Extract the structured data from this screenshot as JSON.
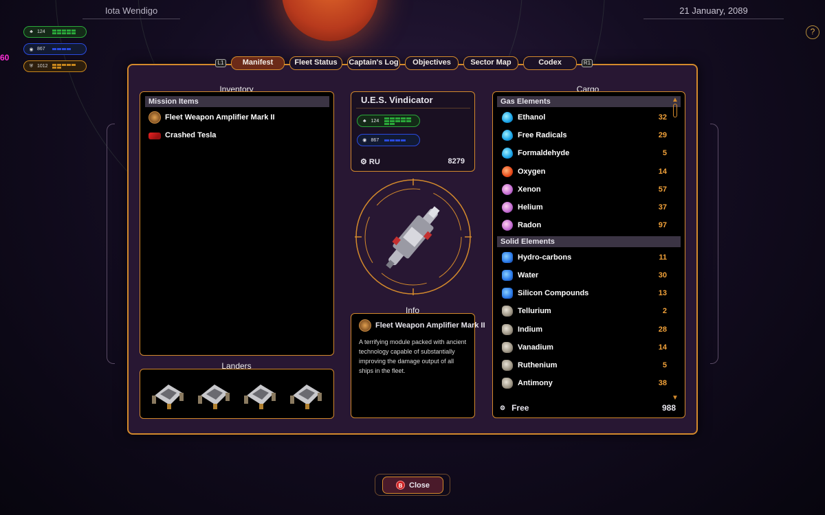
{
  "header": {
    "location": "Iota Wendigo",
    "date": "21 January, 2089",
    "help_glyph": "?",
    "side_counter": "60"
  },
  "hud_stats": [
    {
      "icon": "crew-icon",
      "value": "124",
      "color": "#2aa83a"
    },
    {
      "icon": "eye-icon",
      "value": "867",
      "color": "#2a4ae0"
    },
    {
      "icon": "shield-icon",
      "value": "1012",
      "color": "#c9871c"
    }
  ],
  "tabs": [
    {
      "label": "Manifest",
      "active": true
    },
    {
      "label": "Fleet Status",
      "active": false
    },
    {
      "label": "Captain's Log",
      "active": false
    },
    {
      "label": "Objectives",
      "active": false
    },
    {
      "label": "Sector Map",
      "active": false
    },
    {
      "label": "Codex",
      "active": false
    }
  ],
  "bumpers": {
    "left": "L1",
    "right": "R1"
  },
  "inventory": {
    "title": "Inventory",
    "section": "Mission Items",
    "items": [
      {
        "name": "Fleet Weapon Amplifier Mark II",
        "icon": "amplifier-icon"
      },
      {
        "name": "Crashed Tesla",
        "icon": "car-icon"
      }
    ]
  },
  "ship": {
    "name": "U.E.S. Vindicator",
    "crew": "124",
    "sensors": "867",
    "ru_label": "RU",
    "ru_value": "8279"
  },
  "info": {
    "title": "Info",
    "item_name": "Fleet Weapon Amplifier Mark II",
    "description": "A terrifying module packed with ancient technology capable of substantially improving the damage output of all ships in the fleet."
  },
  "landers": {
    "title": "Landers",
    "count": 4
  },
  "cargo": {
    "title": "Cargo",
    "gas_header": "Gas Elements",
    "gas": [
      {
        "name": "Ethanol",
        "qty": "32",
        "icon": "gas"
      },
      {
        "name": "Free Radicals",
        "qty": "29",
        "icon": "gas"
      },
      {
        "name": "Formaldehyde",
        "qty": "5",
        "icon": "gas"
      },
      {
        "name": "Oxygen",
        "qty": "14",
        "icon": "red"
      },
      {
        "name": "Xenon",
        "qty": "57",
        "icon": "purple"
      },
      {
        "name": "Helium",
        "qty": "37",
        "icon": "purple"
      },
      {
        "name": "Radon",
        "qty": "97",
        "icon": "purple"
      }
    ],
    "solid_header": "Solid Elements",
    "solid": [
      {
        "name": "Hydro-carbons",
        "qty": "11",
        "icon": "blue"
      },
      {
        "name": "Water",
        "qty": "30",
        "icon": "blue"
      },
      {
        "name": "Silicon Compounds",
        "qty": "13",
        "icon": "blue"
      },
      {
        "name": "Tellurium",
        "qty": "2",
        "icon": "rock"
      },
      {
        "name": "Indium",
        "qty": "28",
        "icon": "rock"
      },
      {
        "name": "Vanadium",
        "qty": "14",
        "icon": "rock"
      },
      {
        "name": "Ruthenium",
        "qty": "5",
        "icon": "rock"
      },
      {
        "name": "Antimony",
        "qty": "38",
        "icon": "rock"
      }
    ],
    "free_label": "Free",
    "free_value": "988"
  },
  "close": {
    "button_glyph": "B",
    "label": "Close"
  }
}
